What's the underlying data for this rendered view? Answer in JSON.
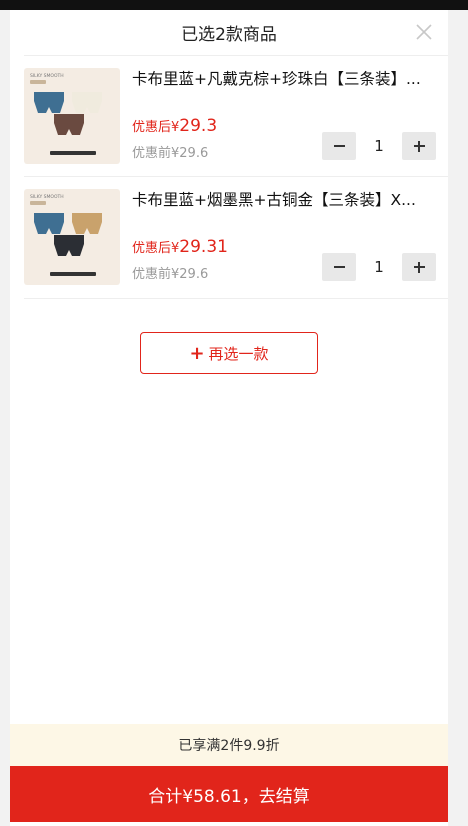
{
  "header": {
    "title": "已选2款商品"
  },
  "items": [
    {
      "name": "卡布里蓝+凡戴克棕+珍珠白【三条装】...",
      "after_label": "优惠后",
      "after_currency": "¥",
      "after_value": "29.3",
      "before_text": "优惠前¥29.6",
      "quantity": "1",
      "thumb_brand": "SILKY SMOOTH",
      "colors": [
        "#3f6f92",
        "#f0ebde",
        "#6a4a40"
      ]
    },
    {
      "name": "卡布里蓝+烟墨黑+古铜金【三条装】X...",
      "after_label": "优惠后",
      "after_currency": "¥",
      "after_value": "29.31",
      "before_text": "优惠前¥29.6",
      "quantity": "1",
      "thumb_brand": "SILKY SMOOTH",
      "colors": [
        "#3f6f92",
        "#2b2e34",
        "#c9a26c"
      ]
    }
  ],
  "add_more": {
    "label": "再选一款"
  },
  "promo": {
    "text": "已享满2件9.9折"
  },
  "checkout": {
    "label": "合计¥58.61，去结算"
  },
  "theme": {
    "accent": "#e1251b",
    "promo_bg": "#fdf7e6"
  }
}
